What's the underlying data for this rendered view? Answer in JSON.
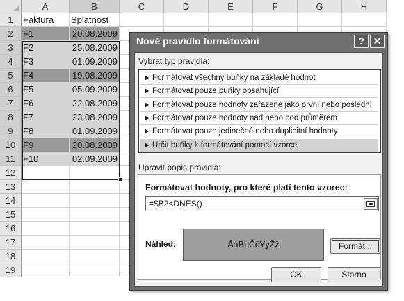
{
  "sheet": {
    "columns": [
      "A",
      "B",
      "C",
      "D",
      "E",
      "F",
      "G",
      "H"
    ],
    "rows": [
      "1",
      "2",
      "3",
      "4",
      "5",
      "6",
      "7",
      "8",
      "9",
      "10",
      "11",
      "12",
      "13",
      "14",
      "15",
      "16",
      "17",
      "18",
      "19"
    ],
    "cells": [
      {
        "a": "Faktura",
        "b": "Splatnost",
        "shade": "none"
      },
      {
        "a": "F1",
        "b": "20.08.2009",
        "shade": "dark"
      },
      {
        "a": "F2",
        "b": "25.08.2009",
        "shade": "light"
      },
      {
        "a": "F3",
        "b": "01.09.2009",
        "shade": "light"
      },
      {
        "a": "F4",
        "b": "19.08.2009",
        "shade": "dark"
      },
      {
        "a": "F5",
        "b": "05.09.2009",
        "shade": "light"
      },
      {
        "a": "F6",
        "b": "22.08.2009",
        "shade": "light"
      },
      {
        "a": "F7",
        "b": "23.08.2009",
        "shade": "light"
      },
      {
        "a": "F8",
        "b": "01.09.2009",
        "shade": "light"
      },
      {
        "a": "F9",
        "b": "20.08.2009",
        "shade": "dark"
      },
      {
        "a": "F10",
        "b": "02.09.2009",
        "shade": "light"
      }
    ]
  },
  "dialog": {
    "title": "Nové pravidlo formátování",
    "help_label": "?",
    "close_label": "✕",
    "select_rule_label": "Vybrat typ pravidla:",
    "rule_types": [
      "Formátovat všechny buňky na základě hodnot",
      "Formátovat pouze buňky obsahující",
      "Formátovat pouze hodnoty zařazené jako první nebo poslední",
      "Formátovat pouze hodnoty nad nebo pod průměrem",
      "Formátovat pouze jedinečné nebo duplicitní hodnoty",
      "Určit buňky k formátování pomocí vzorce"
    ],
    "selected_rule_index": 5,
    "edit_description_label": "Upravit popis pravidla:",
    "formula_header": "Formátovat hodnoty, pro které platí tento vzorec:",
    "formula_value": "=$B2<DNES()",
    "preview_label": "Náhled:",
    "preview_text": "ÁáBbČčYyŽž",
    "format_button": "Formát...",
    "ok_button": "OK",
    "cancel_button": "Storno"
  },
  "colors": {
    "dark_fill": "#9a9a9a",
    "light_fill": "#d6d6d6",
    "dialog_frame": "#6f6f6f"
  }
}
